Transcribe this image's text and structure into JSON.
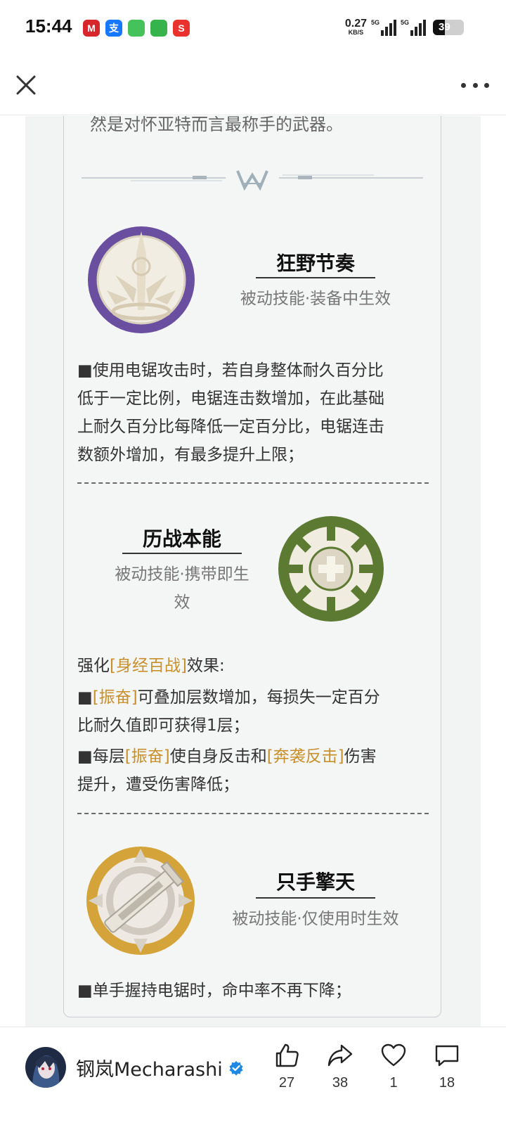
{
  "status_bar": {
    "time": "15:44",
    "net_speed": "0.27",
    "net_unit": "KB/S",
    "signal_1": "5G",
    "signal_2": "5G",
    "battery_level": 39,
    "battery_text": "39",
    "notif_icons": [
      {
        "name": "metro-app-icon",
        "color": "#d6262b",
        "glyph": "M"
      },
      {
        "name": "alipay-icon",
        "color": "#1677ff",
        "glyph": "支"
      },
      {
        "name": "messages-icon",
        "color": "#45c35a",
        "glyph": ""
      },
      {
        "name": "security-shield-icon",
        "color": "#36b34a",
        "glyph": ""
      },
      {
        "name": "suning-icon",
        "color": "#e9322d",
        "glyph": "S"
      }
    ]
  },
  "article": {
    "lead_line": "然是对怀亚特而言最称手的武器。",
    "skills": [
      {
        "title": "狂野节奏",
        "subtitle": "被动技能·装备中生效",
        "emblem_color": "#6a4fa0"
      },
      {
        "title": "历战本能",
        "subtitle_line1": "被动技能·携带即生",
        "subtitle_line2": "效",
        "emblem_color": "#5c7a32"
      },
      {
        "title": "只手擎天",
        "subtitle": "被动技能·仅使用时生效",
        "emblem_color": "#d4a43a"
      }
    ],
    "skill1_para": [
      "■使用电锯攻击时，若自身整体耐久百分比",
      "低于一定比例，电锯连击数增加，在此基础",
      "上耐久百分比每降低一定百分比，电锯连击",
      "数额外增加，有最多提升上限；"
    ],
    "skill2": {
      "intro_pre": "强化",
      "intro_hl": "[身经百战]",
      "intro_post": "效果:",
      "b1_pre": "■",
      "b1_hl": "[振奋]",
      "b1_post": "可叠加层数增加，每损失一定百分",
      "b1_line2": "比耐久值即可获得1层；",
      "b2_pre": "■每层",
      "b2_hl1": "[振奋]",
      "b2_mid": "使自身反击和",
      "b2_hl2": "[奔袭反击]",
      "b2_post": "伤害",
      "b2_line2": "提升，遭受伤害降低；"
    },
    "skill3_para": "■单手握持电锯时，命中率不再下降；"
  },
  "bottom_bar": {
    "author": "钢岚Mecharashi",
    "verified": true,
    "likes": "27",
    "shares": "38",
    "favorites": "1",
    "comments": "18"
  },
  "colors": {
    "highlight": "#c8902c",
    "verified_badge": "#1e88e5"
  }
}
